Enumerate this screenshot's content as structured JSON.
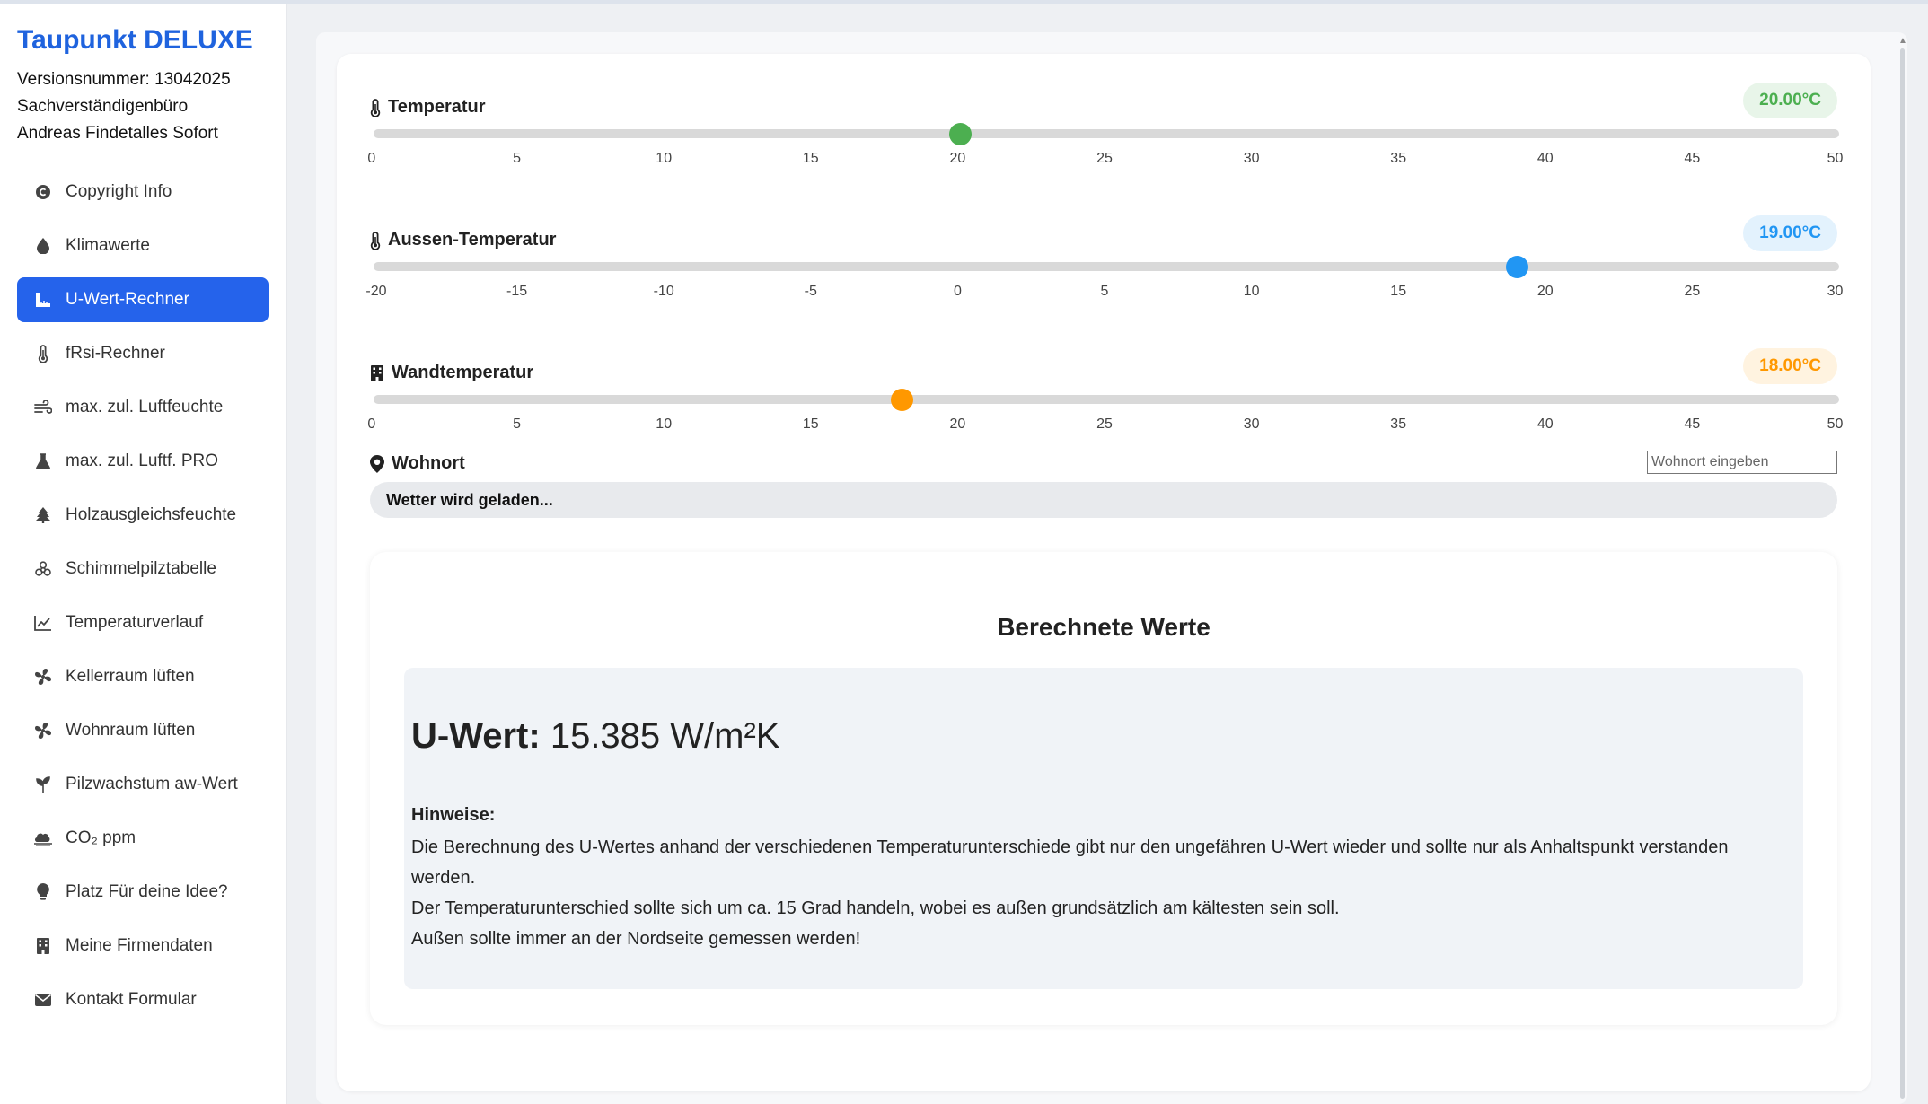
{
  "app": {
    "title": "Taupunkt DELUXE",
    "version": "Versionsnummer: 13042025",
    "office": "Sachverständigenbüro",
    "owner": "Andreas Findetalles Sofort"
  },
  "sidebar": {
    "items": [
      {
        "label": "Copyright Info",
        "icon": "copyright-icon",
        "active": false
      },
      {
        "label": "Klimawerte",
        "icon": "droplet-icon",
        "active": false
      },
      {
        "label": "U-Wert-Rechner",
        "icon": "ruler-icon",
        "active": true
      },
      {
        "label": "fRsi-Rechner",
        "icon": "thermometer-icon",
        "active": false
      },
      {
        "label": "max. zul. Luftfeuchte",
        "icon": "wind-icon",
        "active": false
      },
      {
        "label": "max. zul. Luftf. PRO",
        "icon": "flask-icon",
        "active": false
      },
      {
        "label": "Holzausgleichsfeuchte",
        "icon": "tree-icon",
        "active": false
      },
      {
        "label": "Schimmelpilztabelle",
        "icon": "biohazard-icon",
        "active": false
      },
      {
        "label": "Temperaturverlauf",
        "icon": "chart-line-icon",
        "active": false
      },
      {
        "label": "Kellerraum lüften",
        "icon": "fan-icon",
        "active": false
      },
      {
        "label": "Wohnraum lüften",
        "icon": "fan-icon",
        "active": false
      },
      {
        "label": "Pilzwachstum aw-Wert",
        "icon": "seedling-icon",
        "active": false
      },
      {
        "label": "CO₂ ppm",
        "icon": "smog-icon",
        "active": false
      },
      {
        "label": "Platz Für deine Idee?",
        "icon": "lightbulb-icon",
        "active": false
      },
      {
        "label": "Meine Firmendaten",
        "icon": "building-icon",
        "active": false
      },
      {
        "label": "Kontakt Formular",
        "icon": "envelope-icon",
        "active": false
      }
    ]
  },
  "sliders": [
    {
      "label": "Temperatur",
      "icon": "thermometer-icon",
      "value_text": "20.00°C",
      "value": 20,
      "min": 0,
      "max": 50,
      "ticks": [
        "0",
        "5",
        "10",
        "15",
        "20",
        "25",
        "30",
        "35",
        "40",
        "45",
        "50"
      ],
      "color": "#4caf50",
      "badge_bg": "#e8f5e9"
    },
    {
      "label": "Aussen-Temperatur",
      "icon": "thermometer-icon",
      "value_text": "19.00°C",
      "value": 19,
      "min": -20,
      "max": 30,
      "ticks": [
        "-20",
        "-15",
        "-10",
        "-5",
        "0",
        "5",
        "10",
        "15",
        "20",
        "25",
        "30"
      ],
      "color": "#2196f3",
      "badge_bg": "#e3f2fd"
    },
    {
      "label": "Wandtemperatur",
      "icon": "building-icon",
      "value_text": "18.00°C",
      "value": 18,
      "min": 0,
      "max": 50,
      "ticks": [
        "0",
        "5",
        "10",
        "15",
        "20",
        "25",
        "30",
        "35",
        "40",
        "45",
        "50"
      ],
      "color": "#ff9800",
      "badge_bg": "#fff3e0"
    }
  ],
  "wohnort": {
    "label": "Wohnort",
    "placeholder": "Wohnort eingeben",
    "weather_status": "Wetter wird geladen..."
  },
  "results": {
    "title": "Berechnete Werte",
    "uwert_label": "U-Wert:",
    "uwert_value": "15.385 W/m²K",
    "hinweise_title": "Hinweise:",
    "hinweise_lines": [
      "Die Berechnung des U-Wertes anhand der verschiedenen Temperaturunterschiede gibt nur den ungefähren U-Wert wieder und sollte nur als Anhaltspunkt verstanden werden.",
      "Der Temperaturunterschied sollte sich um ca. 15 Grad handeln, wobei es außen grundsätzlich am kältesten sein soll.",
      "Außen sollte immer an der Nordseite gemessen werden!"
    ]
  }
}
